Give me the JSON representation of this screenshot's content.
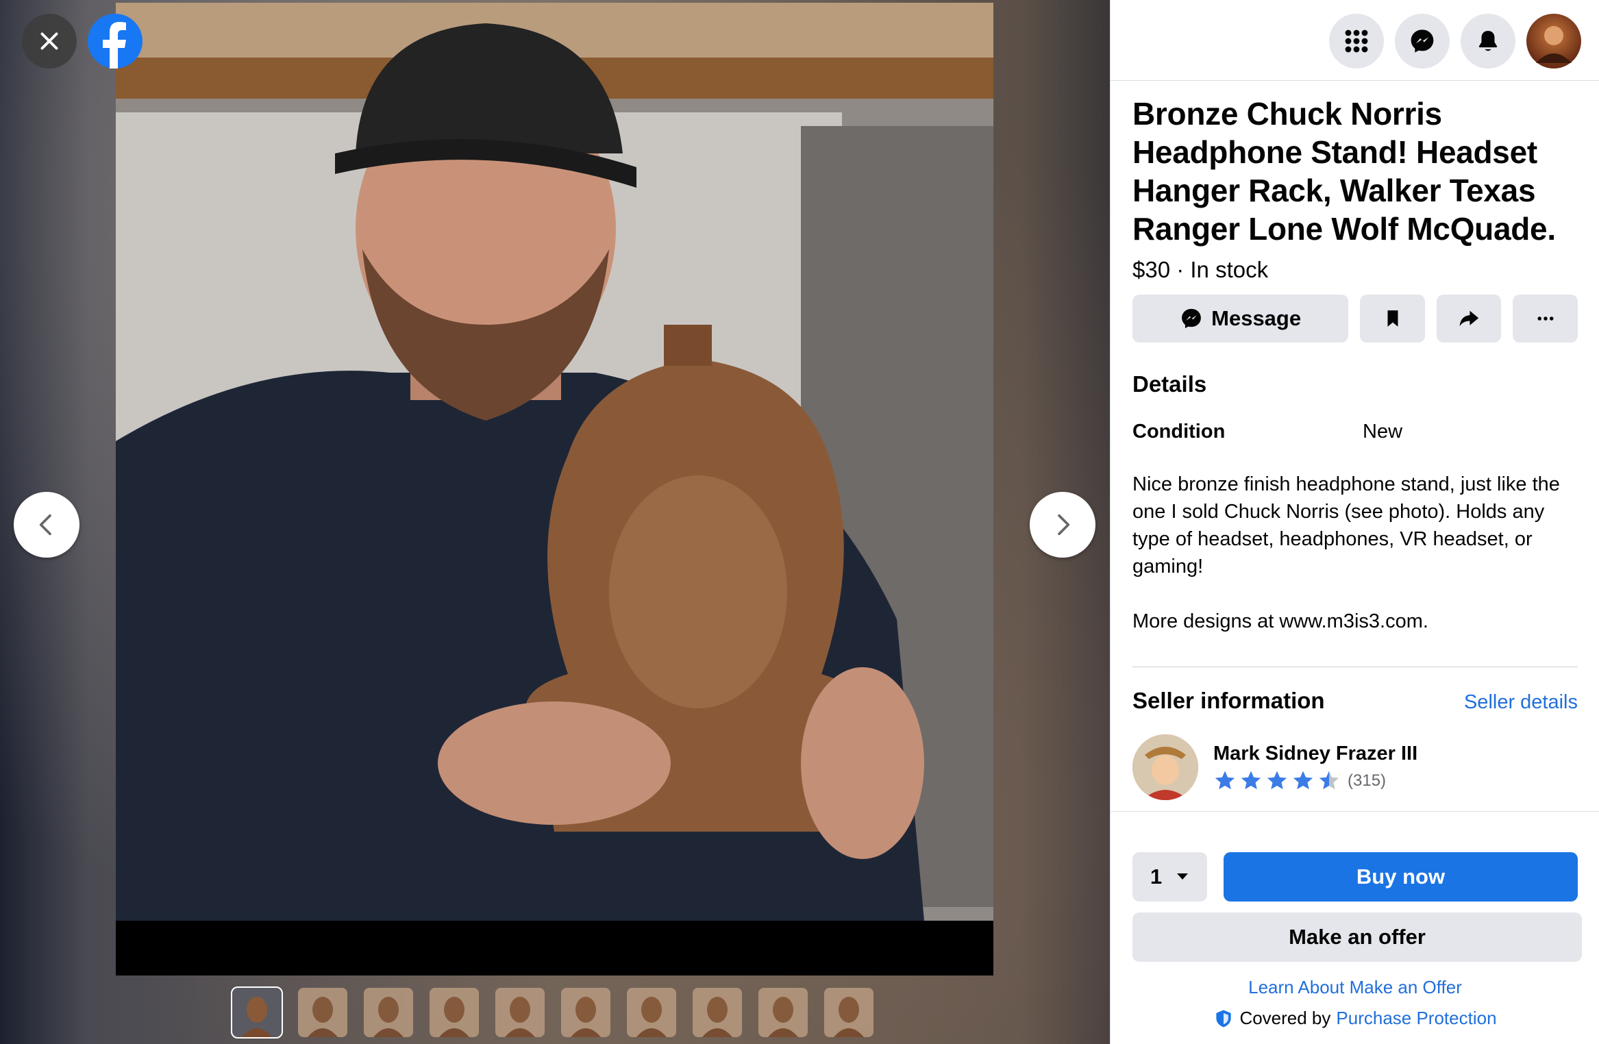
{
  "viewer": {
    "photo_alt": "Chuck Norris holding bronze bust headphone stand",
    "thumbnail_count": 10,
    "active_thumbnail": 0
  },
  "listing": {
    "title": "Bronze Chuck Norris Headphone Stand! Headset Hanger Rack, Walker Texas Ranger Lone Wolf McQuade.",
    "price_line": "$30 · In stock",
    "actions": {
      "message_label": "Message"
    },
    "details_heading": "Details",
    "condition_label": "Condition",
    "condition_value": "New",
    "description": "Nice bronze finish headphone stand, just like the one I sold Chuck Norris (see photo). Holds any type of headset, headphones, VR headset, or gaming!\n\nMore designs at www.m3is3.com."
  },
  "seller": {
    "heading": "Seller information",
    "details_link": "Seller details",
    "name": "Mark Sidney Frazer III",
    "rating": 4.5,
    "rating_count": "(315)"
  },
  "purchase": {
    "quantity": "1",
    "buy_now_label": "Buy now",
    "offer_label": "Make an offer",
    "learn_link": "Learn About Make an Offer",
    "covered_by": "Covered by",
    "protection_link": "Purchase Protection"
  },
  "colors": {
    "brand_blue": "#1877f2",
    "button_blue": "#1b74e4",
    "link_blue": "#216fdb",
    "star_blue": "#3b7ce6",
    "button_gray": "#e4e6eb"
  },
  "icons": {
    "close": "close-icon",
    "facebook": "facebook-logo-icon",
    "prev": "chevron-left-icon",
    "next": "chevron-right-icon",
    "menu": "grid-menu-icon",
    "messenger": "messenger-icon",
    "notifications": "bell-icon",
    "save": "bookmark-icon",
    "share": "share-arrow-icon",
    "more": "more-dots-icon",
    "qty_dropdown": "caret-down-icon",
    "protection": "shield-icon"
  }
}
